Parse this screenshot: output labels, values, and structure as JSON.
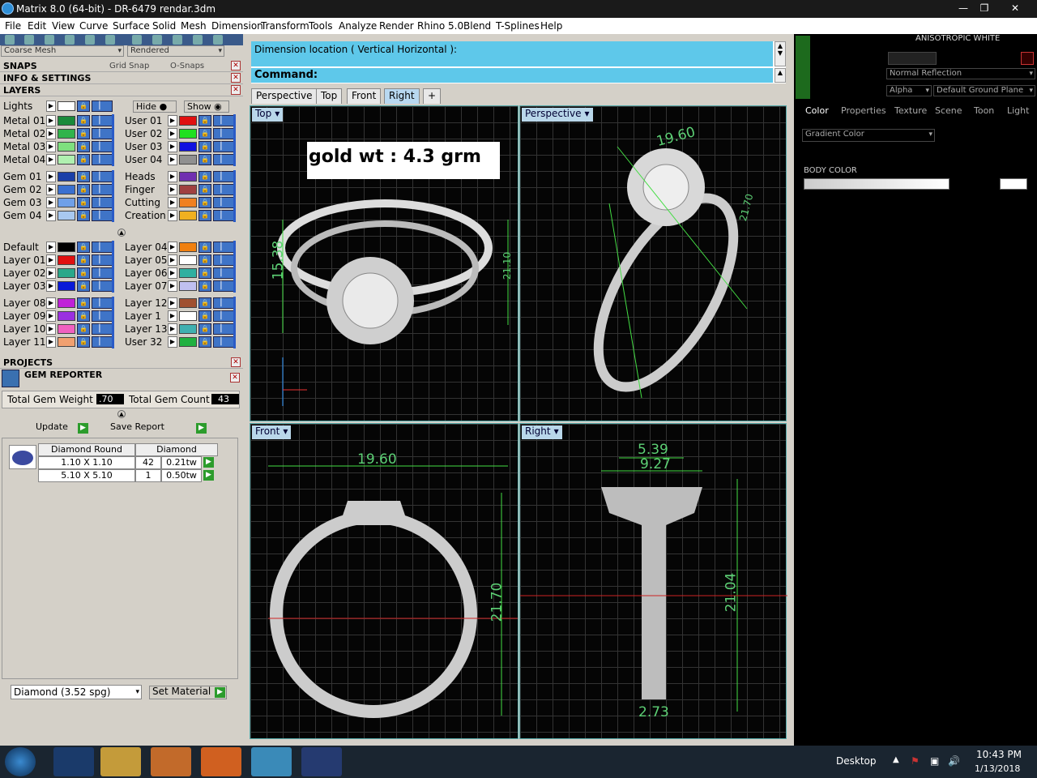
{
  "title": "Matrix 8.0 (64-bit) - DR-6479 rendar.3dm",
  "window_controls": {
    "minimize": "—",
    "maximize": "❐",
    "close": "✕"
  },
  "menu": [
    "File",
    "Edit",
    "View",
    "Curve",
    "Surface",
    "Solid",
    "Mesh",
    "Dimension",
    "Transform",
    "Tools",
    "Analyze",
    "Render",
    "Rhino 5.0",
    "Blend",
    "T-Splines",
    "Help"
  ],
  "toolbar": {
    "mesh_mode": "Coarse Mesh",
    "display_mode": "Rendered"
  },
  "snaps": {
    "header": "SNAPS",
    "grid_snap": "Grid Snap",
    "osnaps": "O-Snaps"
  },
  "info_header": "INFO & SETTINGS",
  "layers": {
    "header": "LAYERS",
    "lights_label": "Lights",
    "hide_label": "Hide",
    "show_label": "Show",
    "left": [
      {
        "name": "Metal 01",
        "color": "#1a8a3a"
      },
      {
        "name": "Metal 02",
        "color": "#31b44b"
      },
      {
        "name": "Metal 03",
        "color": "#7ee07e"
      },
      {
        "name": "Metal 04",
        "color": "#b0f0b0"
      },
      {
        "name": "Gem 01",
        "color": "#1b3fa8"
      },
      {
        "name": "Gem 02",
        "color": "#3a70d0"
      },
      {
        "name": "Gem 03",
        "color": "#6fa0e8"
      },
      {
        "name": "Gem 04",
        "color": "#a8c8f0"
      },
      {
        "name": "Default",
        "color": "#000000"
      },
      {
        "name": "Layer 01",
        "color": "#e01010"
      },
      {
        "name": "Layer 02",
        "color": "#2aa88a"
      },
      {
        "name": "Layer 03",
        "color": "#0a1ad8"
      },
      {
        "name": "Layer 08",
        "color": "#c020d8"
      },
      {
        "name": "Layer 09",
        "color": "#9a30e0"
      },
      {
        "name": "Layer 10",
        "color": "#f060c0"
      },
      {
        "name": "Layer 11",
        "color": "#f0a070"
      }
    ],
    "right": [
      {
        "name": "User 01",
        "color": "#e01010"
      },
      {
        "name": "User 02",
        "color": "#20e020"
      },
      {
        "name": "User 03",
        "color": "#1010e0"
      },
      {
        "name": "User 04",
        "color": "#909090"
      },
      {
        "name": "Heads",
        "color": "#7030b0"
      },
      {
        "name": "Finger",
        "color": "#a04040"
      },
      {
        "name": "Cutting",
        "color": "#f08020"
      },
      {
        "name": "Creation",
        "color": "#f0b020"
      },
      {
        "name": "Layer 04",
        "color": "#f08010"
      },
      {
        "name": "Layer 05",
        "color": "#ffffff"
      },
      {
        "name": "Layer 06",
        "color": "#30b0a0"
      },
      {
        "name": "Layer 07",
        "color": "#c0c0f0"
      },
      {
        "name": "Layer 12",
        "color": "#a05030"
      },
      {
        "name": "Layer 1",
        "color": "#ffffff"
      },
      {
        "name": "Layer 13",
        "color": "#40b0b0"
      },
      {
        "name": "User 32",
        "color": "#20b040"
      }
    ]
  },
  "projects_header": "PROJECTS",
  "gem_reporter": {
    "header": "GEM REPORTER",
    "total_weight_label": "Total Gem Weight",
    "total_weight": ".70",
    "total_count_label": "Total Gem Count",
    "total_count": "43",
    "update": "Update",
    "save_report": "Save Report",
    "col1": "Diamond Round",
    "col2": "Diamond",
    "rows": [
      {
        "size": "1.10 X 1.10",
        "count": "42",
        "weight": "0.21tw"
      },
      {
        "size": "5.10 X 5.10",
        "count": "1",
        "weight": "0.50tw"
      }
    ],
    "material": "Diamond    (3.52 spg)",
    "set_material": "Set Material"
  },
  "command": {
    "line1": "Dimension location ( Vertical  Horizontal ):",
    "line2": "Command:"
  },
  "view_tabs": [
    "Perspective",
    "Top",
    "Front",
    "Right",
    "+"
  ],
  "viewports": {
    "top": {
      "label": "Top",
      "annotation": "gold wt : 4.3 grm",
      "dim_v": "15.38",
      "dim_h": "21.10"
    },
    "perspective": {
      "label": "Perspective",
      "dim1": "19.60",
      "dim2": "21.70"
    },
    "front": {
      "label": "Front",
      "dim_w": "19.60",
      "dim_h": "21.70"
    },
    "right": {
      "label": "Right",
      "dim1": "5.39",
      "dim2": "9.27",
      "dim_h": "21.04",
      "dim_b": "2.73"
    }
  },
  "right_panel": {
    "material_name": "ANISOTROPIC WHITE",
    "reflection": "Normal Reflection",
    "alpha": "Alpha",
    "ground": "Default Ground Plane",
    "tabs": [
      "Color",
      "Properties",
      "Texture",
      "Scene",
      "Toon",
      "Light"
    ],
    "color_mode": "Gradient Color",
    "body_color": "BODY COLOR"
  },
  "taskbar": {
    "desktop": "Desktop",
    "time": "10:43 PM",
    "date": "1/13/2018"
  }
}
